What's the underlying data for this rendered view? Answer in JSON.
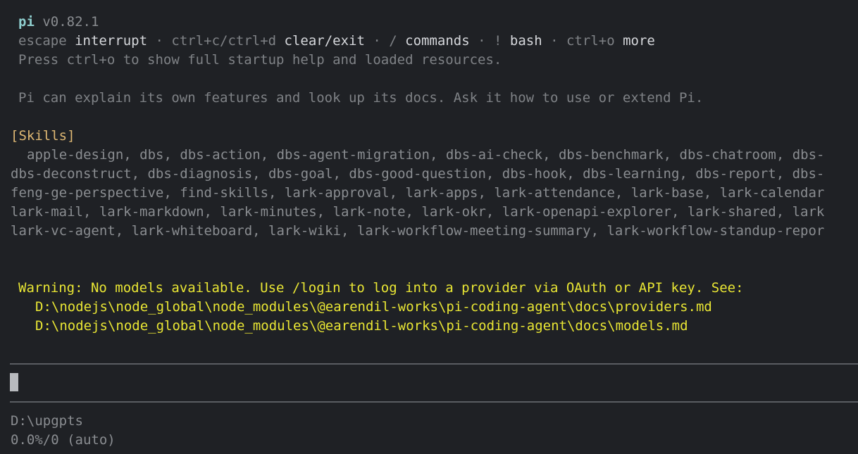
{
  "header": {
    "app_name": "pi",
    "version": "v0.82.1"
  },
  "keybind_hints": [
    {
      "key": "escape",
      "action": "interrupt"
    },
    {
      "key": "ctrl+c/ctrl+d",
      "action": "clear/exit"
    },
    {
      "key": "/",
      "action": "commands"
    },
    {
      "key": "!",
      "action": "bash"
    },
    {
      "key": "ctrl+o",
      "action": "more"
    }
  ],
  "separator": " · ",
  "startup_hint": "Press ctrl+o to show full startup help and loaded resources.",
  "intro": "Pi can explain its own features and look up its docs. Ask it how to use or extend Pi.",
  "skills": {
    "header": "[Skills]",
    "lines": [
      "apple-design, dbs, dbs-action, dbs-agent-migration, dbs-ai-check, dbs-benchmark, dbs-chatroom, dbs-",
      "dbs-deconstruct, dbs-diagnosis, dbs-goal, dbs-good-question, dbs-hook, dbs-learning, dbs-report, dbs-",
      "feng-ge-perspective, find-skills, lark-approval, lark-apps, lark-attendance, lark-base, lark-calendar",
      "lark-mail, lark-markdown, lark-minutes, lark-note, lark-okr, lark-openapi-explorer, lark-shared, lark",
      "lark-vc-agent, lark-whiteboard, lark-wiki, lark-workflow-meeting-summary, lark-workflow-standup-repor"
    ]
  },
  "warning": {
    "message": "Warning: No models available. Use /login to log into a provider via OAuth or API key. See:",
    "paths": [
      "D:\\nodejs\\node_global\\node_modules\\@earendil-works\\pi-coding-agent\\docs\\providers.md",
      "D:\\nodejs\\node_global\\node_modules\\@earendil-works\\pi-coding-agent\\docs\\models.md"
    ]
  },
  "prompt": {
    "value": ""
  },
  "footer": {
    "cwd": "D:\\upgpts",
    "context": "0.0%/0 (auto)"
  },
  "colors": {
    "background": "#1f2125",
    "app_name": "#8fcfcf",
    "highlight": "#d6d8dc",
    "dim": "#8a8d91",
    "skills_header": "#e0b974",
    "warning": "#e9e634",
    "rule": "#5a5d62"
  }
}
